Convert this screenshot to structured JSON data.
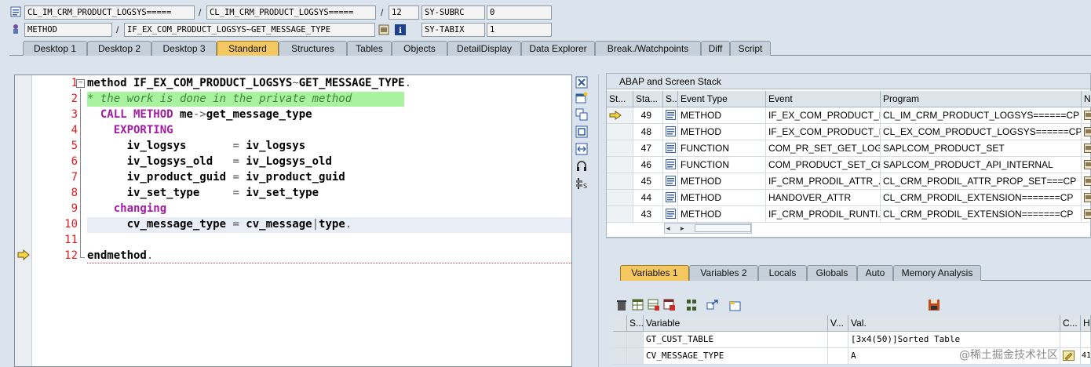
{
  "header": {
    "row1": {
      "program": "CL_IM_CRM_PRODUCT_LOGSYS=====",
      "include": "CL_IM_CRM_PRODUCT_LOGSYS=====",
      "line": "12",
      "var_name": "SY-SUBRC",
      "var_value": "0"
    },
    "row2": {
      "event_type": "METHOD",
      "event": "IF_EX_COM_PRODUCT_LOGSYS~GET_MESSAGE_TYPE",
      "var_name": "SY-TABIX",
      "var_value": "1"
    },
    "sep": "/"
  },
  "tabs": [
    "Desktop 1",
    "Desktop 2",
    "Desktop 3",
    "Standard",
    "Structures",
    "Tables",
    "Objects",
    "DetailDisplay",
    "Data Explorer",
    "Break./Watchpoints",
    "Diff",
    "Script"
  ],
  "active_tab": "Standard",
  "editor": {
    "line_numbers": [
      "1",
      "2",
      "3",
      "4",
      "5",
      "6",
      "7",
      "8",
      "9",
      "10",
      "11",
      "12"
    ],
    "lines": [
      {
        "parts": [
          {
            "t": "method IF_EX_COM_PRODUCT_LOGSYS",
            "c": ""
          },
          {
            "t": "~",
            "c": "op"
          },
          {
            "t": "GET_MESSAGE_TYPE",
            "c": ""
          },
          {
            "t": ".",
            "c": "op"
          }
        ]
      },
      {
        "parts": [
          {
            "t": "* the work is done in the private method",
            "c": "cm"
          }
        ]
      },
      {
        "parts": [
          {
            "t": "  CALL METHOD ",
            "c": "kw"
          },
          {
            "t": "me",
            "c": ""
          },
          {
            "t": "->",
            "c": "op"
          },
          {
            "t": "get_message_type",
            "c": ""
          }
        ]
      },
      {
        "parts": [
          {
            "t": "    EXPORTING",
            "c": "kw"
          }
        ]
      },
      {
        "parts": [
          {
            "t": "      iv_logsys       ",
            "c": ""
          },
          {
            "t": "=",
            "c": "op"
          },
          {
            "t": " iv_logsys",
            "c": ""
          }
        ]
      },
      {
        "parts": [
          {
            "t": "      iv_logsys_old   ",
            "c": ""
          },
          {
            "t": "=",
            "c": "op"
          },
          {
            "t": " iv_Logsys_old",
            "c": ""
          }
        ]
      },
      {
        "parts": [
          {
            "t": "      iv_product_guid ",
            "c": ""
          },
          {
            "t": "=",
            "c": "op"
          },
          {
            "t": " iv_product_guid",
            "c": ""
          }
        ]
      },
      {
        "parts": [
          {
            "t": "      iv_set_type     ",
            "c": ""
          },
          {
            "t": "=",
            "c": "op"
          },
          {
            "t": " iv_set_type",
            "c": ""
          }
        ]
      },
      {
        "parts": [
          {
            "t": "    changing",
            "c": "kw"
          }
        ]
      },
      {
        "parts": [
          {
            "t": "      cv_message_type ",
            "c": ""
          },
          {
            "t": "=",
            "c": "op"
          },
          {
            "t": " cv_message",
            "c": ""
          },
          {
            "t": "|",
            "c": "op"
          },
          {
            "t": "type",
            "c": ""
          },
          {
            "t": ".",
            "c": "op"
          }
        ]
      },
      {
        "parts": []
      },
      {
        "parts": [
          {
            "t": "endmethod",
            "c": ""
          },
          {
            "t": ".",
            "c": "op"
          }
        ]
      }
    ],
    "current_line": "12"
  },
  "stack": {
    "title": "ABAP and Screen Stack",
    "columns": [
      "St...",
      "Sta...",
      "S...",
      "Event Type",
      "Event",
      "Program",
      "Na"
    ],
    "rows": [
      {
        "level": "49",
        "type": "METHOD",
        "event": "IF_EX_COM_PRODUCT_L...",
        "program": "CL_IM_CRM_PRODUCT_LOGSYS======CP",
        "current": true
      },
      {
        "level": "48",
        "type": "METHOD",
        "event": "IF_EX_COM_PRODUCT_L...",
        "program": "CL_EX_COM_PRODUCT_LOGSYS======CP",
        "current": false
      },
      {
        "level": "47",
        "type": "FUNCTION",
        "event": "COM_PR_SET_GET_LOG...",
        "program": "SAPLCOM_PRODUCT_SET",
        "current": false
      },
      {
        "level": "46",
        "type": "FUNCTION",
        "event": "COM_PRODUCT_SET_CH...",
        "program": "SAPLCOM_PRODUCT_API_INTERNAL",
        "current": false
      },
      {
        "level": "45",
        "type": "METHOD",
        "event": "IF_CRM_PRODIL_ATTR_...",
        "program": "CL_CRM_PRODIL_ATTR_PROP_SET===CP",
        "current": false
      },
      {
        "level": "44",
        "type": "METHOD",
        "event": "HANDOVER_ATTR",
        "program": "CL_CRM_PRODIL_EXTENSION=======CP",
        "current": false
      },
      {
        "level": "43",
        "type": "METHOD",
        "event": "IF_CRM_PRODIL_RUNTI...",
        "program": "CL_CRM_PRODIL_EXTENSION=======CP",
        "current": false
      }
    ]
  },
  "var_tabs": [
    "Variables 1",
    "Variables 2",
    "Locals",
    "Globals",
    "Auto",
    "Memory Analysis"
  ],
  "var_active": "Variables 1",
  "variables": {
    "columns": [
      "S...",
      "Variable",
      "V...",
      "Val.",
      "C...",
      "He"
    ],
    "rows": [
      {
        "name": "GT_CUST_TABLE",
        "value": "[3x4(50)]Sorted Table",
        "extra": ""
      },
      {
        "name": "CV_MESSAGE_TYPE",
        "value": "A",
        "extra": "41"
      }
    ]
  },
  "watermark": "@稀土掘金技术社区"
}
